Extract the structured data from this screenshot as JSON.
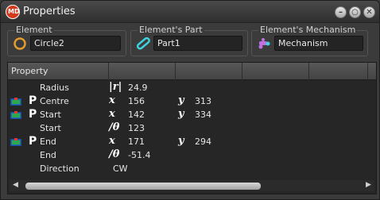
{
  "window": {
    "title": "Properties"
  },
  "window_buttons": {
    "minimize": "–",
    "restore": "○",
    "close": "✕"
  },
  "app_icon_text": "MD",
  "groups": {
    "element": {
      "label": "Element",
      "value": "Circle2",
      "icon": "circle-icon"
    },
    "part": {
      "label": "Element's Part",
      "value": "Part1",
      "icon": "link-part-icon"
    },
    "mechanism": {
      "label": "Element's Mechanism",
      "value": "Mechanism",
      "icon": "mechanism-icon"
    }
  },
  "table": {
    "headers": [
      "Property",
      "",
      "",
      "",
      "",
      ""
    ],
    "rows": [
      {
        "name": "Radius",
        "pin": false,
        "icon": false,
        "sym1": "|r|",
        "val1": "24.9",
        "sym2": "",
        "val2": ""
      },
      {
        "name": "Centre",
        "pin": true,
        "icon": true,
        "sym1": "x",
        "val1": "156",
        "sym2": "y",
        "val2": "313"
      },
      {
        "name": "Start",
        "pin": true,
        "icon": true,
        "sym1": "x",
        "val1": "142",
        "sym2": "y",
        "val2": "334"
      },
      {
        "name": "Start",
        "pin": false,
        "icon": false,
        "sym1": "/θ",
        "val1": "123",
        "sym2": "",
        "val2": ""
      },
      {
        "name": "End",
        "pin": true,
        "icon": true,
        "sym1": "x",
        "val1": "171",
        "sym2": "y",
        "val2": "294"
      },
      {
        "name": "End",
        "pin": false,
        "icon": false,
        "sym1": "/θ",
        "val1": "-51.4",
        "sym2": "",
        "val2": ""
      },
      {
        "name": "Direction",
        "pin": false,
        "icon": false,
        "sym1": "",
        "val1": "CW",
        "sym2": "",
        "val2": ""
      }
    ],
    "pin_label": "P"
  },
  "scrollbar": {
    "left_arrow": "◀",
    "right_arrow": "▶"
  },
  "colors": {
    "accent": "#d33a1c",
    "part_icon": "#3fd3e0",
    "mech_icon": "#c070e0"
  }
}
